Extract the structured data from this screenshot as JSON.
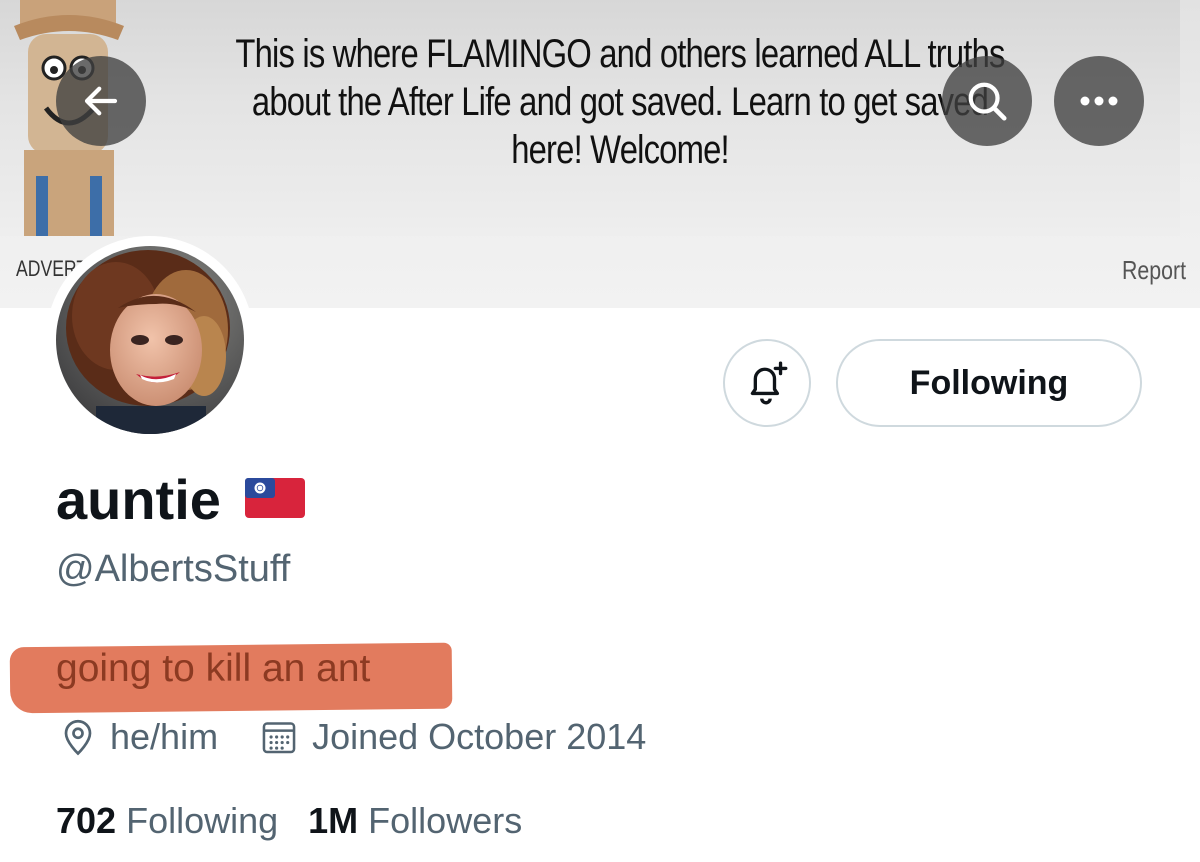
{
  "banner": {
    "text": "This is where FLAMINGO and others learned ALL truths about the After Life and got saved. Learn to get saved here! Welcome!",
    "ad_label": "ADVERT",
    "report_label": "Report"
  },
  "nav": {
    "back_icon": "arrow-left-icon",
    "search_icon": "search-icon",
    "more_icon": "more-horizontal-icon"
  },
  "profile": {
    "display_name": "auntie",
    "flag_icon": "taiwan-flag-icon",
    "handle": "@AlbertsStuff",
    "bio": "going to kill an ant",
    "location": "he/him",
    "joined": "Joined October 2014",
    "following_count": "702",
    "following_label": "Following",
    "followers_count": "1M",
    "followers_label": "Followers"
  },
  "actions": {
    "notify_icon": "bell-plus-icon",
    "follow_button_label": "Following"
  },
  "colors": {
    "text_primary": "#0f1419",
    "text_secondary": "#536471",
    "border": "#cfd9de",
    "highlight": "#e27b5e"
  }
}
